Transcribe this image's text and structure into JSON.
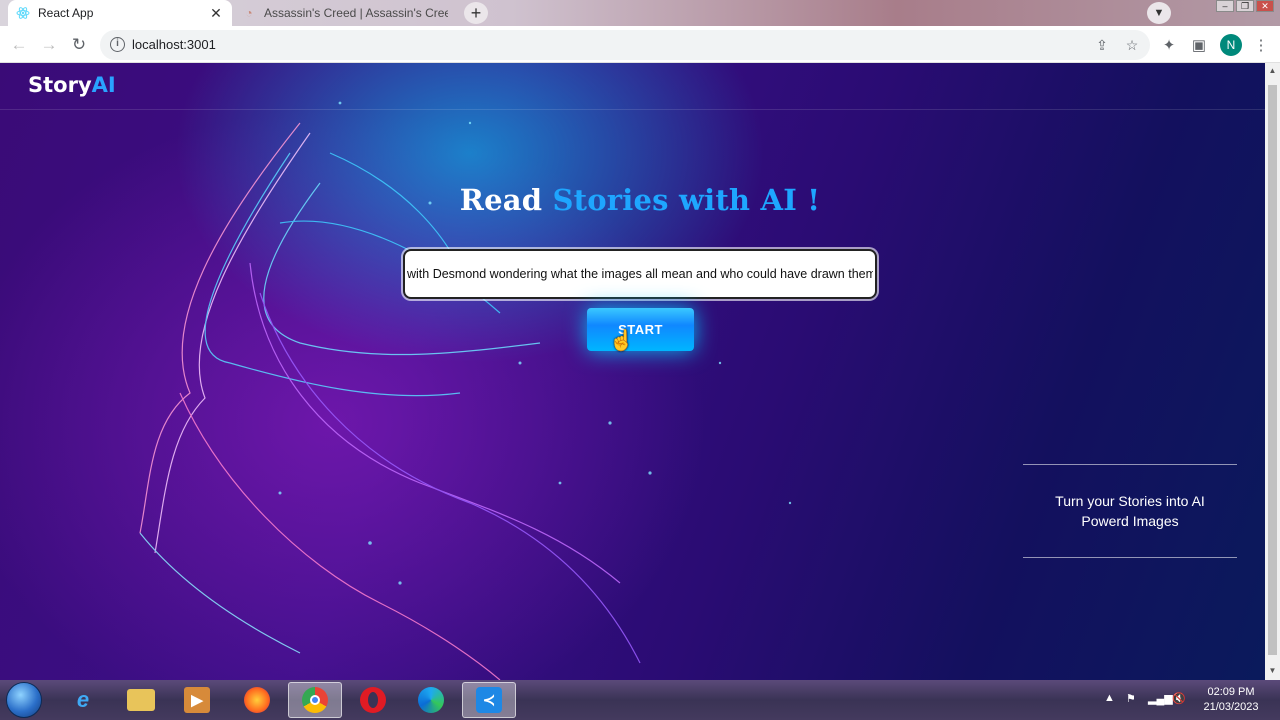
{
  "browser": {
    "tabs": [
      {
        "title": "React App",
        "favicon": "react-icon",
        "active": true
      },
      {
        "title": "Assassin's Creed | Assassin's Cree",
        "favicon": "page-icon",
        "active": false
      }
    ],
    "url": "localhost:3001",
    "profile_initial": "N"
  },
  "page": {
    "logo": {
      "story": "Story",
      "ai": "AI"
    },
    "headline": {
      "lead": "Read",
      "accent": "Stories with AI !"
    },
    "story_input_value": "with Desmond wondering what the images all mean and who could have drawn them.",
    "start_label": "START",
    "side_text": "Turn your Stories into AI Powerd Images",
    "colors": {
      "accent": "#1ea6ff",
      "button": "#1088ff"
    }
  },
  "taskbar": {
    "apps": [
      "internet-explorer-icon",
      "file-explorer-icon",
      "media-player-icon",
      "firefox-icon",
      "chrome-icon",
      "opera-icon",
      "edge-icon",
      "vscode-icon"
    ],
    "time": "02:09 PM",
    "date": "21/03/2023"
  }
}
